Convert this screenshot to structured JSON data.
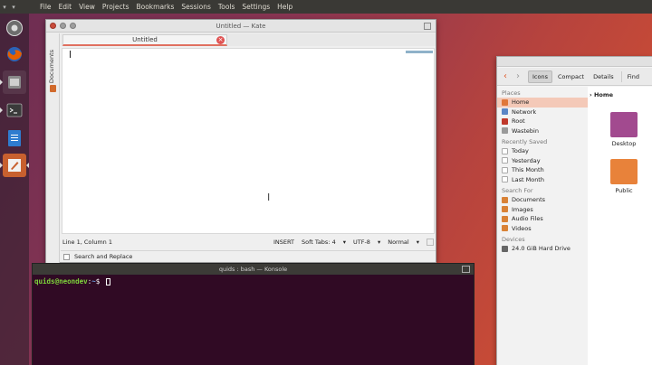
{
  "menubar": {
    "items": [
      "File",
      "Edit",
      "View",
      "Projects",
      "Bookmarks",
      "Sessions",
      "Tools",
      "Settings",
      "Help"
    ]
  },
  "launcher": {
    "items": [
      {
        "name": "system-settings-icon",
        "color": "#6d6d6d"
      },
      {
        "name": "firefox-icon",
        "color": "#e66000"
      },
      {
        "name": "files-icon",
        "color": "#8a8a8a"
      },
      {
        "name": "terminal-icon",
        "color": "#3a3a3a"
      },
      {
        "name": "writer-icon",
        "color": "#2f7ccf"
      },
      {
        "name": "kate-icon",
        "color": "#c8602f"
      }
    ]
  },
  "kate": {
    "title": "Untitled — Kate",
    "sidebar_label": "Documents",
    "tab_label": "Untitled",
    "status_position": "Line 1, Column 1",
    "status_mode": "INSERT",
    "status_tabs": "Soft Tabs: 4",
    "status_encoding": "UTF-8",
    "status_highlight": "Normal",
    "search_label": "Search and Replace"
  },
  "files": {
    "view_buttons": [
      "Icons",
      "Compact",
      "Details",
      "Find"
    ],
    "active_view": "Icons",
    "breadcrumb": "Home",
    "sections": {
      "places": "Places",
      "recent": "Recently Saved",
      "search": "Search For",
      "devices": "Devices"
    },
    "places": [
      "Home",
      "Network",
      "Root",
      "Wastebin"
    ],
    "recent": [
      "Today",
      "Yesterday",
      "This Month",
      "Last Month"
    ],
    "search": [
      "Documents",
      "Images",
      "Audio Files",
      "Videos"
    ],
    "devices": [
      "24.0 GiB Hard Drive"
    ],
    "folders": [
      "Desktop",
      "Public"
    ]
  },
  "konsole": {
    "title": "quids : bash — Konsole",
    "prompt_user": "quids@neondev",
    "prompt_sep": ":",
    "prompt_path": "~",
    "prompt_symbol": "$"
  },
  "colors": {
    "accent": "#e05a2b",
    "selection": "#f4c9b8",
    "terminal_bg": "#300a24",
    "prompt_user": "#7ed43b",
    "prompt_path": "#6c9fe0"
  }
}
